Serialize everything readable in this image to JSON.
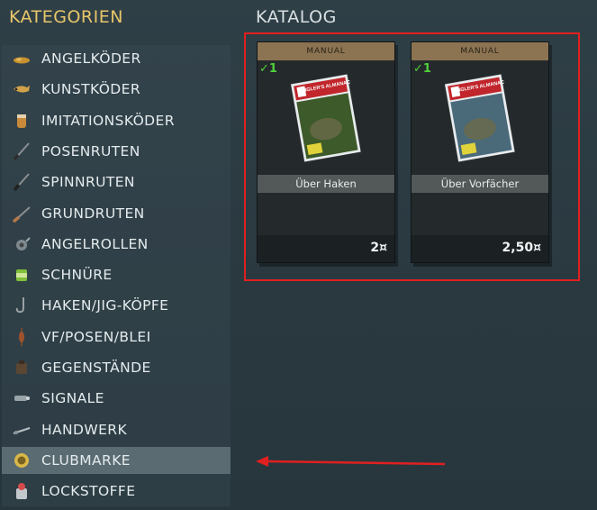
{
  "categories_heading": "KATEGORIEN",
  "catalog_heading": "KATALOG",
  "categories": [
    {
      "label": "ANGELKÖDER",
      "icon": "bait-icon"
    },
    {
      "label": "KUNSTKÖDER",
      "icon": "lure-icon"
    },
    {
      "label": "IMITATIONSKÖDER",
      "icon": "imitation-bait-icon"
    },
    {
      "label": "POSENRUTEN",
      "icon": "float-rod-icon"
    },
    {
      "label": "SPINNRUTEN",
      "icon": "spinning-rod-icon"
    },
    {
      "label": "GRUNDRUTEN",
      "icon": "bottom-rod-icon"
    },
    {
      "label": "ANGELROLLEN",
      "icon": "reel-icon"
    },
    {
      "label": "SCHNÜRE",
      "icon": "line-spool-icon"
    },
    {
      "label": "HAKEN/JIG-KÖPFE",
      "icon": "hook-icon"
    },
    {
      "label": "VF/POSEN/BLEI",
      "icon": "float-icon"
    },
    {
      "label": "GEGENSTÄNDE",
      "icon": "items-icon"
    },
    {
      "label": "SIGNALE",
      "icon": "bite-alarm-icon"
    },
    {
      "label": "HANDWERK",
      "icon": "craft-icon"
    },
    {
      "label": "CLUBMARKE",
      "icon": "club-token-icon",
      "selected": true
    },
    {
      "label": "LOCKSTOFFE",
      "icon": "groundbait-icon"
    }
  ],
  "products": [
    {
      "type": "MANUAL",
      "check": "✓1",
      "name": "Über Haken",
      "price": "2¤",
      "cover_title": "ANGLER'S ALMANAC",
      "cover_color": "#3d5a2a"
    },
    {
      "type": "MANUAL",
      "check": "✓1",
      "name": "Über Vorfächer",
      "price": "2,50¤",
      "cover_title": "ANGLER'S ALMANAC",
      "cover_color": "#4a6a7a"
    }
  ],
  "colors": {
    "accent": "#e8c66a",
    "highlight": "#e02020",
    "card_header": "#8c7452",
    "check": "#4fd13b"
  }
}
